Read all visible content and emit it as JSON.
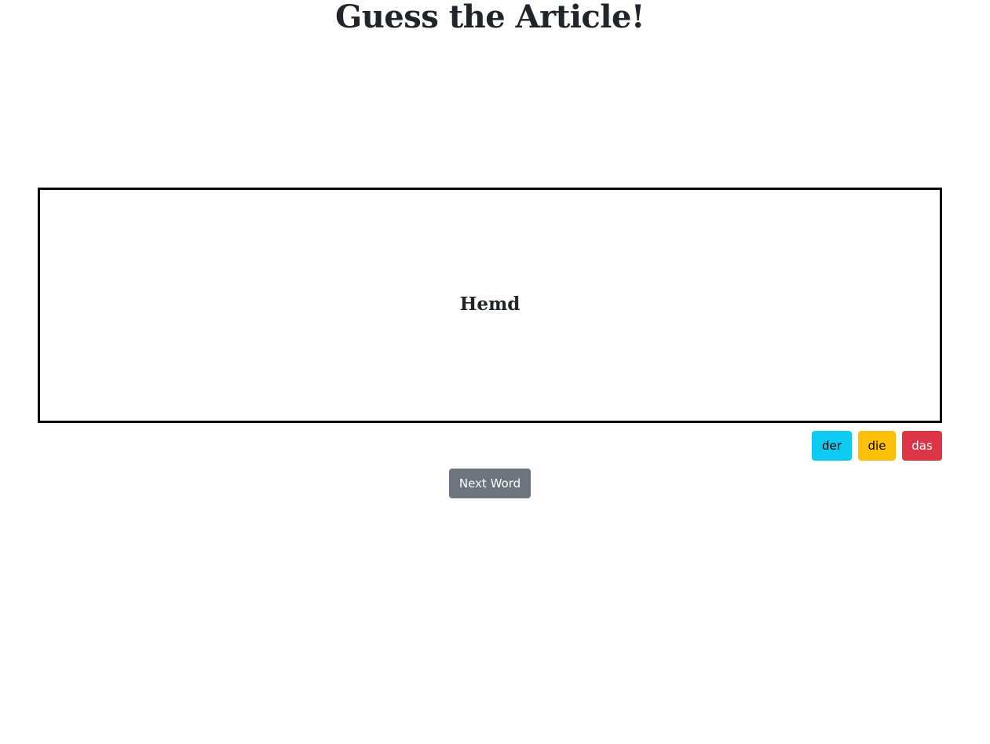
{
  "header": {
    "title": "Guess the Article!"
  },
  "card": {
    "word": "Hemd"
  },
  "articles": {
    "der_label": "der",
    "die_label": "die",
    "das_label": "das"
  },
  "actions": {
    "next_label": "Next Word"
  },
  "colors": {
    "der": "#0dcaf0",
    "die": "#ffc107",
    "das": "#dc3545",
    "next": "#6c757d",
    "card_border": "#000000",
    "text": "#212529"
  }
}
